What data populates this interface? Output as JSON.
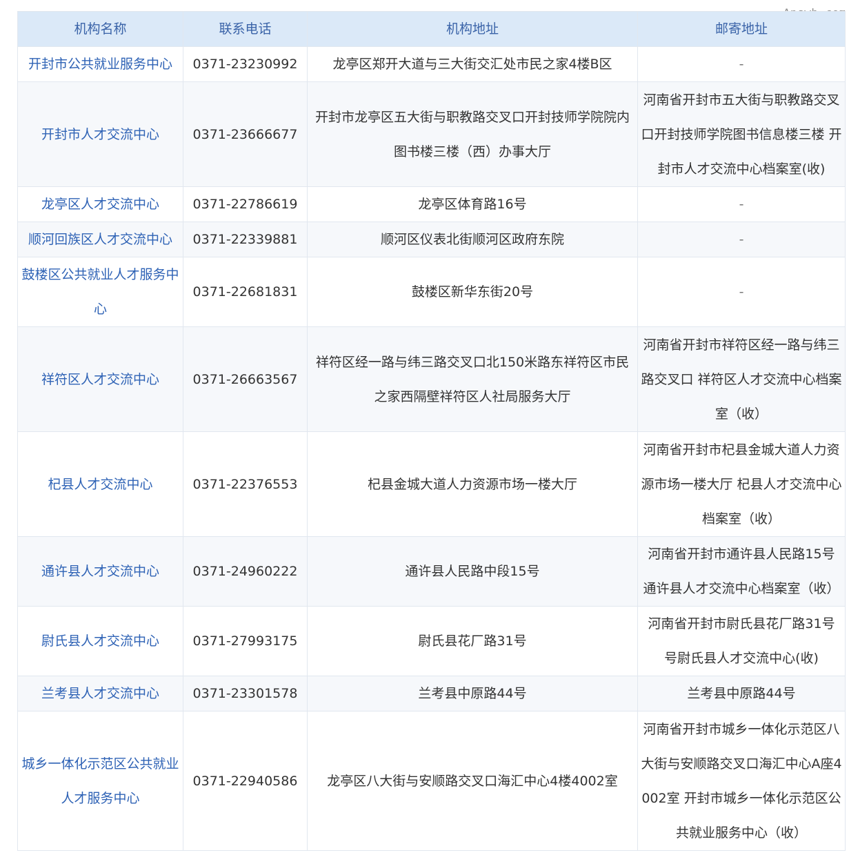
{
  "watermark": "Answh.com",
  "headers": [
    "机构名称",
    "联系电话",
    "机构地址",
    "邮寄地址"
  ],
  "rows": [
    {
      "name": "开封市公共就业服务中心",
      "phone": "0371-23230992",
      "address": "龙亭区郑开大道与三大街交汇处市民之家4楼B区",
      "mail": "-"
    },
    {
      "name": "开封市人才交流中心",
      "phone": "0371-23666677",
      "address": "开封市龙亭区五大街与职教路交叉口开封技师学院院内图书楼三楼（西）办事大厅",
      "mail": "河南省开封市五大街与职教路交叉口开封技师学院图书信息楼三楼 开封市人才交流中心档案室(收)"
    },
    {
      "name": "龙亭区人才交流中心",
      "phone": "0371-22786619",
      "address": "龙亭区体育路16号",
      "mail": "-"
    },
    {
      "name": "顺河回族区人才交流中心",
      "phone": "0371-22339881",
      "address": "顺河区仪表北街顺河区政府东院",
      "mail": "-"
    },
    {
      "name": "鼓楼区公共就业人才服务中心",
      "phone": "0371-22681831",
      "address": "鼓楼区新华东街20号",
      "mail": "-"
    },
    {
      "name": "祥符区人才交流中心",
      "phone": "0371-26663567",
      "address": "祥符区经一路与纬三路交叉口北150米路东祥符区市民之家西隔壁祥符区人社局服务大厅",
      "mail": "河南省开封市祥符区经一路与纬三路交叉口 祥符区人才交流中心档案室（收）"
    },
    {
      "name": "杞县人才交流中心",
      "phone": "0371-22376553",
      "address": "杞县金城大道人力资源市场一楼大厅",
      "mail": "河南省开封市杞县金城大道人力资源市场一楼大厅 杞县人才交流中心档案室（收）"
    },
    {
      "name": "通许县人才交流中心",
      "phone": "0371-24960222",
      "address": "通许县人民路中段15号",
      "mail": "河南省开封市通许县人民路15号 通许县人才交流中心档案室（收）"
    },
    {
      "name": "尉氏县人才交流中心",
      "phone": "0371-27993175",
      "address": "尉氏县花厂路31号",
      "mail": "河南省开封市尉氏县花厂路31号 号尉氏县人才交流中心(收)"
    },
    {
      "name": "兰考县人才交流中心",
      "phone": "0371-23301578",
      "address": "兰考县中原路44号",
      "mail": "兰考县中原路44号"
    },
    {
      "name": "城乡一体化示范区公共就业人才服务中心",
      "phone": "0371-22940586",
      "address": "龙亭区八大街与安顺路交叉口海汇中心4楼4002室",
      "mail": "河南省开封市城乡一体化示范区八大街与安顺路交叉口海汇中心A座4002室 开封市城乡一体化示范区公共就业服务中心（收）"
    }
  ]
}
